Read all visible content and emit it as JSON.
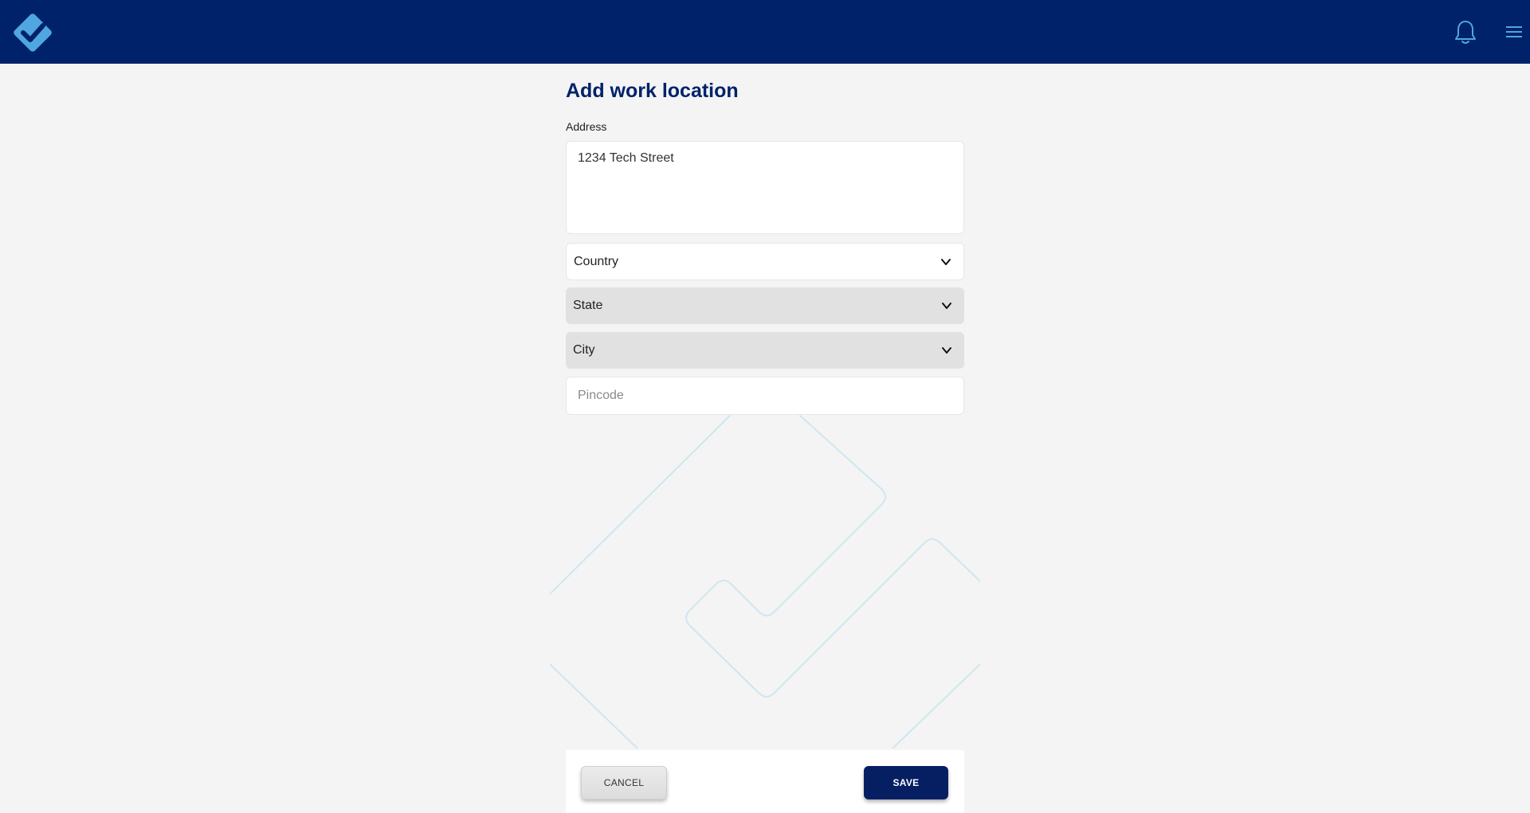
{
  "header": {
    "logo_icon": "checkmark-diamond-logo",
    "notification_icon": "bell-icon",
    "menu_icon": "hamburger-menu-icon",
    "bg_color": "#00226a",
    "accent_color": "#4fa6e0"
  },
  "form": {
    "title": "Add work location",
    "address_label": "Address",
    "address_value": "1234 Tech Street",
    "country_label": "Country",
    "state_label": "State",
    "city_label": "City",
    "pincode_placeholder": "Pincode"
  },
  "footer": {
    "cancel_label": "CANCEL",
    "save_label": "SAVE"
  }
}
